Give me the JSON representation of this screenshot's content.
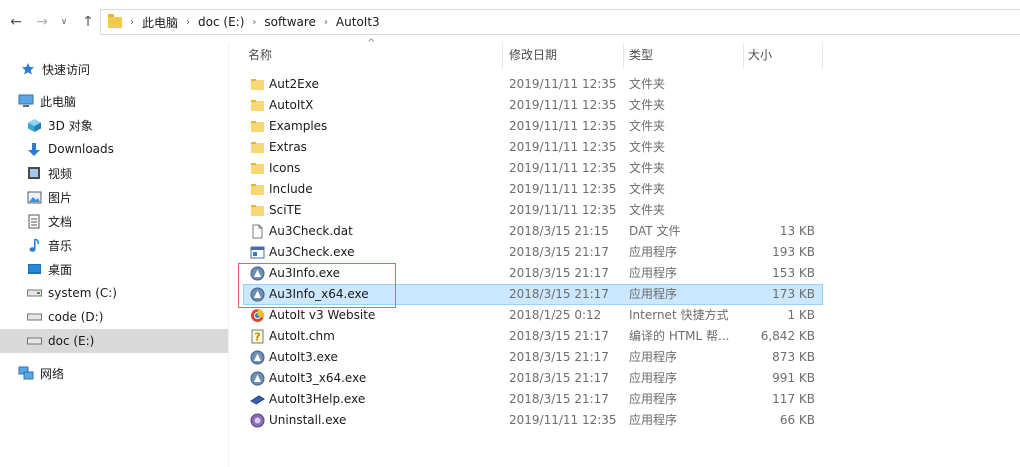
{
  "address_bar": {
    "crumbs": [
      "此电脑",
      "doc (E:)",
      "software",
      "AutoIt3"
    ]
  },
  "sidebar": {
    "items": [
      {
        "label": "快速访问",
        "icon": "star-icon"
      },
      {
        "label": "此电脑",
        "icon": "computer-icon"
      },
      {
        "label": "3D 对象",
        "icon": "cube-icon"
      },
      {
        "label": "Downloads",
        "icon": "download-arrow-icon"
      },
      {
        "label": "视频",
        "icon": "video-icon"
      },
      {
        "label": "图片",
        "icon": "picture-icon"
      },
      {
        "label": "文档",
        "icon": "document-icon"
      },
      {
        "label": "音乐",
        "icon": "music-note-icon"
      },
      {
        "label": "桌面",
        "icon": "desktop-icon"
      },
      {
        "label": "system (C:)",
        "icon": "drive-icon"
      },
      {
        "label": "code (D:)",
        "icon": "drive-icon"
      },
      {
        "label": "doc (E:)",
        "icon": "drive-icon"
      },
      {
        "label": "网络",
        "icon": "network-icon"
      }
    ]
  },
  "columns": {
    "name": "名称",
    "date": "修改日期",
    "type": "类型",
    "size": "大小"
  },
  "files": [
    {
      "name": "Aut2Exe",
      "date": "2019/11/11 12:35",
      "type": "文件夹",
      "size": "",
      "icon": "folder-icon"
    },
    {
      "name": "AutoItX",
      "date": "2019/11/11 12:35",
      "type": "文件夹",
      "size": "",
      "icon": "folder-icon"
    },
    {
      "name": "Examples",
      "date": "2019/11/11 12:35",
      "type": "文件夹",
      "size": "",
      "icon": "folder-icon"
    },
    {
      "name": "Extras",
      "date": "2019/11/11 12:35",
      "type": "文件夹",
      "size": "",
      "icon": "folder-icon"
    },
    {
      "name": "Icons",
      "date": "2019/11/11 12:35",
      "type": "文件夹",
      "size": "",
      "icon": "folder-icon"
    },
    {
      "name": "Include",
      "date": "2019/11/11 12:35",
      "type": "文件夹",
      "size": "",
      "icon": "folder-icon"
    },
    {
      "name": "SciTE",
      "date": "2019/11/11 12:35",
      "type": "文件夹",
      "size": "",
      "icon": "folder-icon"
    },
    {
      "name": "Au3Check.dat",
      "date": "2018/3/15 21:15",
      "type": "DAT 文件",
      "size": "13 KB",
      "icon": "file-icon"
    },
    {
      "name": "Au3Check.exe",
      "date": "2018/3/15 21:17",
      "type": "应用程序",
      "size": "193 KB",
      "icon": "app-window-icon"
    },
    {
      "name": "Au3Info.exe",
      "date": "2018/3/15 21:17",
      "type": "应用程序",
      "size": "153 KB",
      "icon": "au3info-icon"
    },
    {
      "name": "Au3Info_x64.exe",
      "date": "2018/3/15 21:17",
      "type": "应用程序",
      "size": "173 KB",
      "icon": "au3info-icon"
    },
    {
      "name": "AutoIt v3 Website",
      "date": "2018/1/25 0:12",
      "type": "Internet 快捷方式",
      "size": "1 KB",
      "icon": "web-shortcut-icon"
    },
    {
      "name": "AutoIt.chm",
      "date": "2018/3/15 21:17",
      "type": "编译的 HTML 帮...",
      "size": "6,842 KB",
      "icon": "help-file-icon"
    },
    {
      "name": "AutoIt3.exe",
      "date": "2018/3/15 21:17",
      "type": "应用程序",
      "size": "873 KB",
      "icon": "autoit-icon"
    },
    {
      "name": "AutoIt3_x64.exe",
      "date": "2018/3/15 21:17",
      "type": "应用程序",
      "size": "991 KB",
      "icon": "autoit-icon"
    },
    {
      "name": "AutoIt3Help.exe",
      "date": "2018/3/15 21:17",
      "type": "应用程序",
      "size": "117 KB",
      "icon": "book-icon"
    },
    {
      "name": "Uninstall.exe",
      "date": "2019/11/11 12:35",
      "type": "应用程序",
      "size": "66 KB",
      "icon": "uninstall-icon"
    }
  ],
  "selected_file": "Au3Info_x64.exe"
}
